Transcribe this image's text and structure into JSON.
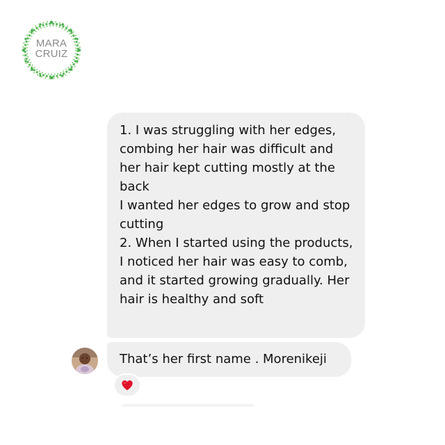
{
  "logo": {
    "line1": "MARA",
    "line2": "CRUIZ",
    "icon": "leaf-wreath-icon",
    "wreath_color": "#5cb85c"
  },
  "messages": [
    {
      "lines": [
        "1. I was struggling with her edges, combing her hair was difficult and her hair kept cutting mostly at the back",
        "I wanted her edges to grow and stop cutting",
        "2. When I started using the products, I noticed her hair was easy to comb, and it started growing gradually. Her hair is healthy and soft"
      ]
    },
    {
      "text": "That’s her first name . Morenikeji",
      "reaction_icon": "heart-icon",
      "avatar_icon": "child-avatar-icon"
    }
  ],
  "colors": {
    "bubble": "#efefef",
    "text": "#111111",
    "heart": "#e0132b",
    "logo_text": "#8a8a8a"
  }
}
